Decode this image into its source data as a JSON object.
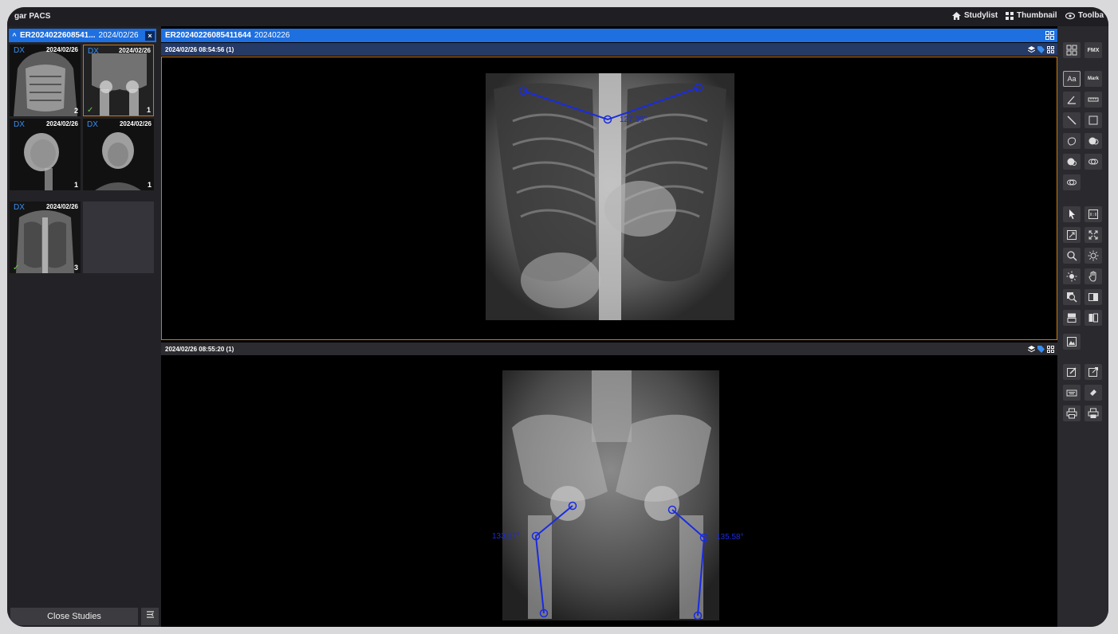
{
  "app": {
    "title": "gar PACS"
  },
  "topnav": [
    {
      "icon": "home-icon",
      "label": "Studylist"
    },
    {
      "icon": "grid-icon",
      "label": "Thumbnail"
    },
    {
      "icon": "eye-icon",
      "label": "Toolba"
    }
  ],
  "study": {
    "id": "ER2024022608541...",
    "date": "2024/02/26",
    "close_label": "×",
    "collapse_label": "^"
  },
  "thumbnails": [
    {
      "modality": "DX",
      "date": "2024/02/26",
      "count": "2",
      "checked": false
    },
    {
      "modality": "DX",
      "date": "2024/02/26",
      "count": "1",
      "checked": true
    },
    {
      "modality": "DX",
      "date": "2024/02/26",
      "count": "1",
      "checked": false
    },
    {
      "modality": "DX",
      "date": "2024/02/26",
      "count": "1",
      "checked": false
    },
    {
      "modality": "DX",
      "date": "2024/02/26",
      "count": "3",
      "checked": true
    }
  ],
  "checkmark": "✓",
  "close_studies": "Close Studies",
  "viewer": {
    "study_id": "ER20240226085411644",
    "study_date": "20240226",
    "panes": [
      {
        "label": "2024/02/26 08:54:56 (1)",
        "angle": "127.39°"
      },
      {
        "label": "2024/02/26 08:55:20 (1)",
        "angle_left": "133.37°",
        "angle_right": "135.58°"
      }
    ]
  },
  "toolbar": {
    "fmx": "FMX",
    "text": "Aa",
    "mark": "Mark"
  },
  "colors": {
    "accent": "#1e6fe0",
    "annotation": "#1a2be0",
    "selected_border": "#c47a1e"
  }
}
